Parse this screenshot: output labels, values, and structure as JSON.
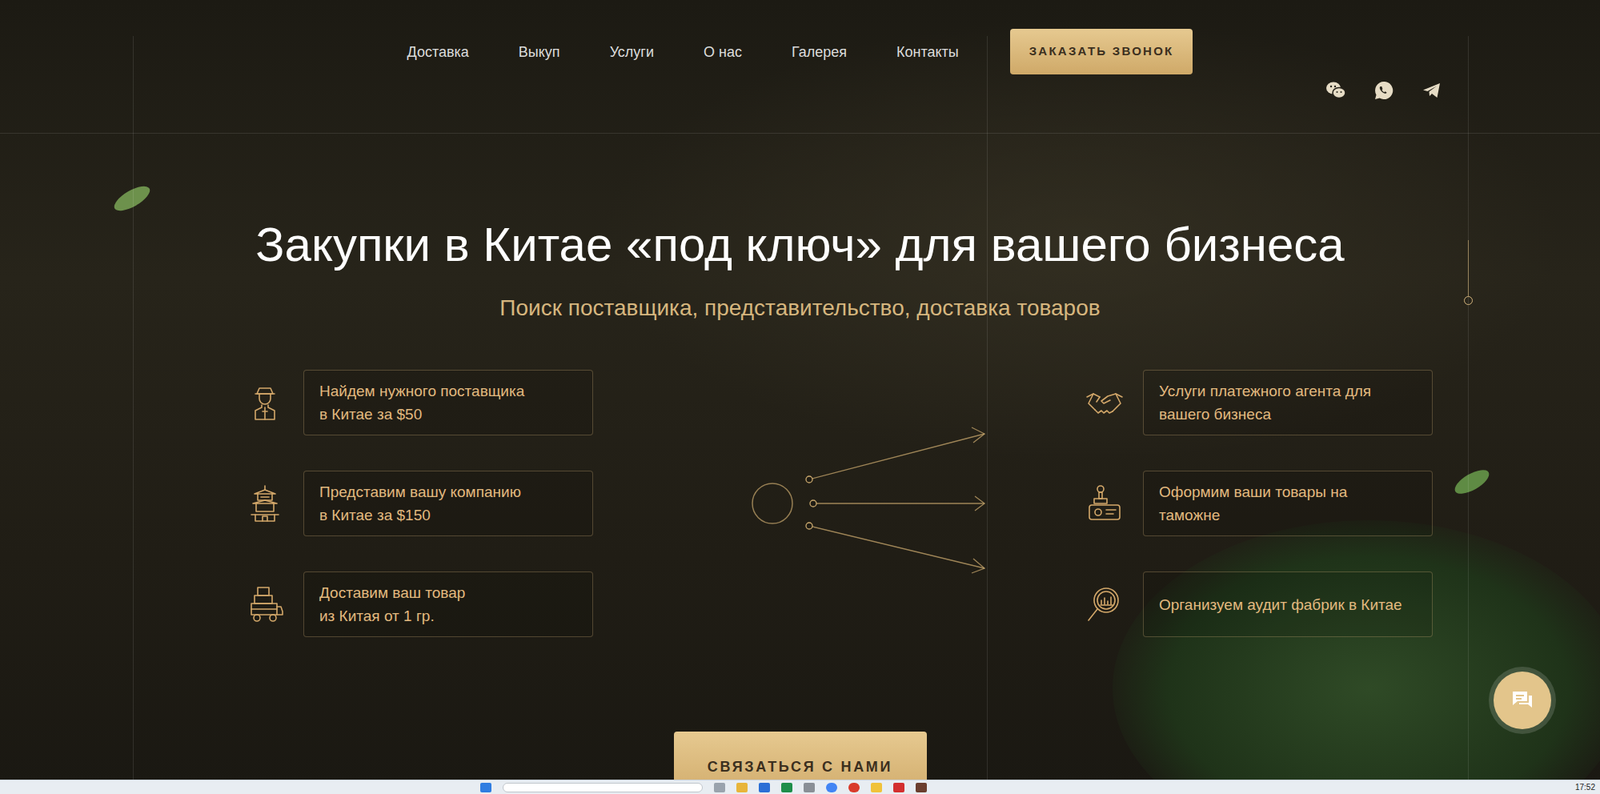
{
  "nav": {
    "items": [
      "Доставка",
      "Выкуп",
      "Услуги",
      "О нас",
      "Галерея",
      "Контакты"
    ],
    "callback_button": "ЗАКАЗАТЬ ЗВОНОК"
  },
  "hero": {
    "title": "Закупки в Китае «под ключ» для вашего бизнеса",
    "subtitle": "Поиск поставщика, представительство, доставка товаров"
  },
  "services_left": [
    {
      "lines": [
        "Найдем нужного поставщика",
        "в Китае за $50"
      ]
    },
    {
      "lines": [
        "Представим вашу компанию",
        "в Китае за $150"
      ]
    },
    {
      "lines": [
        "Доставим ваш товар",
        "из Китая от 1 гр."
      ]
    }
  ],
  "services_right": [
    {
      "lines": [
        "Услуги платежного агента для",
        "вашего бизнеса"
      ]
    },
    {
      "lines": [
        "Оформим ваши товары на",
        "таможне"
      ]
    },
    {
      "lines": [
        "Организуем аудит фабрик в Китае"
      ]
    }
  ],
  "cta_button": "СВЯЗАТЬСЯ С НАМИ",
  "taskbar": {
    "time": "17:52"
  }
}
